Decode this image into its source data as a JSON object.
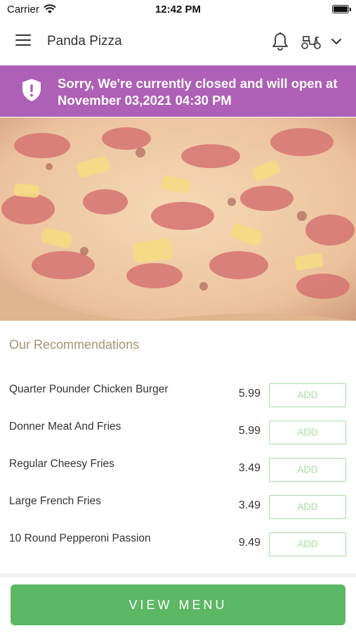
{
  "status_bar": {
    "carrier": "Carrier",
    "time": "12:42 PM"
  },
  "nav": {
    "title": "Panda Pizza",
    "icons": [
      "menu-icon",
      "bell-icon",
      "scooter-icon",
      "chevron-down-icon"
    ]
  },
  "banner": {
    "message": "Sorry, We're currently closed and will open at November 03,2021 04:30 PM",
    "color": "#ae5fb6"
  },
  "recommendations": {
    "title": "Our Recommendations",
    "items": [
      {
        "name": "Quarter Pounder Chicken Burger",
        "price": "5.99",
        "button": "ADD"
      },
      {
        "name": "Donner Meat And Fries",
        "price": "5.99",
        "button": "ADD"
      },
      {
        "name": "Regular Cheesy Fries",
        "price": "3.49",
        "button": "ADD"
      },
      {
        "name": "Large French Fries",
        "price": "3.49",
        "button": "ADD"
      },
      {
        "name": "10 Round Pepperoni Passion",
        "price": "9.49",
        "button": "ADD"
      }
    ]
  },
  "footer": {
    "view_menu_label": "VIEW MENU",
    "accent": "#5cb865"
  }
}
